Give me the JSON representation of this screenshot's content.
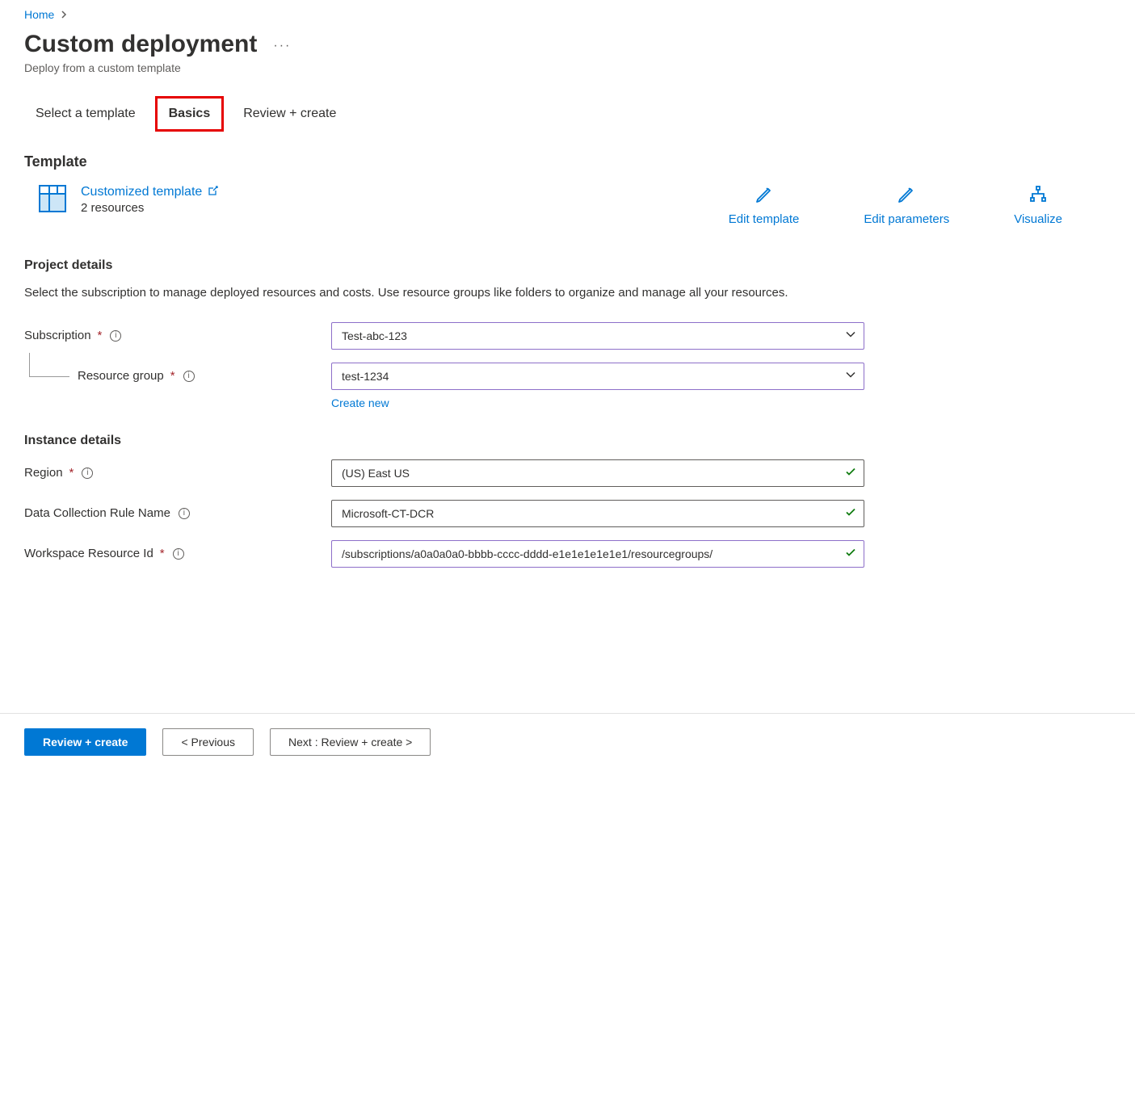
{
  "breadcrumb": {
    "home": "Home"
  },
  "header": {
    "title": "Custom deployment",
    "subtitle": "Deploy from a custom template"
  },
  "tabs": {
    "select_template": "Select a template",
    "basics": "Basics",
    "review_create": "Review + create"
  },
  "template_section": {
    "heading": "Template",
    "link_label": "Customized template",
    "resource_count": "2 resources",
    "actions": {
      "edit_template": "Edit template",
      "edit_parameters": "Edit parameters",
      "visualize": "Visualize"
    }
  },
  "project_details": {
    "heading": "Project details",
    "description": "Select the subscription to manage deployed resources and costs. Use resource groups like folders to organize and manage all your resources.",
    "subscription_label": "Subscription",
    "subscription_value": "Test-abc-123",
    "resource_group_label": "Resource group",
    "resource_group_value": "test-1234",
    "create_new": "Create new"
  },
  "instance_details": {
    "heading": "Instance details",
    "region_label": "Region",
    "region_value": "(US) East US",
    "dcr_label": "Data Collection Rule Name",
    "dcr_value": "Microsoft-CT-DCR",
    "workspace_label": "Workspace Resource Id",
    "workspace_value": "/subscriptions/a0a0a0a0-bbbb-cccc-dddd-e1e1e1e1e1e1/resourcegroups/"
  },
  "footer": {
    "review_create": "Review + create",
    "previous": "< Previous",
    "next": "Next : Review + create >"
  }
}
